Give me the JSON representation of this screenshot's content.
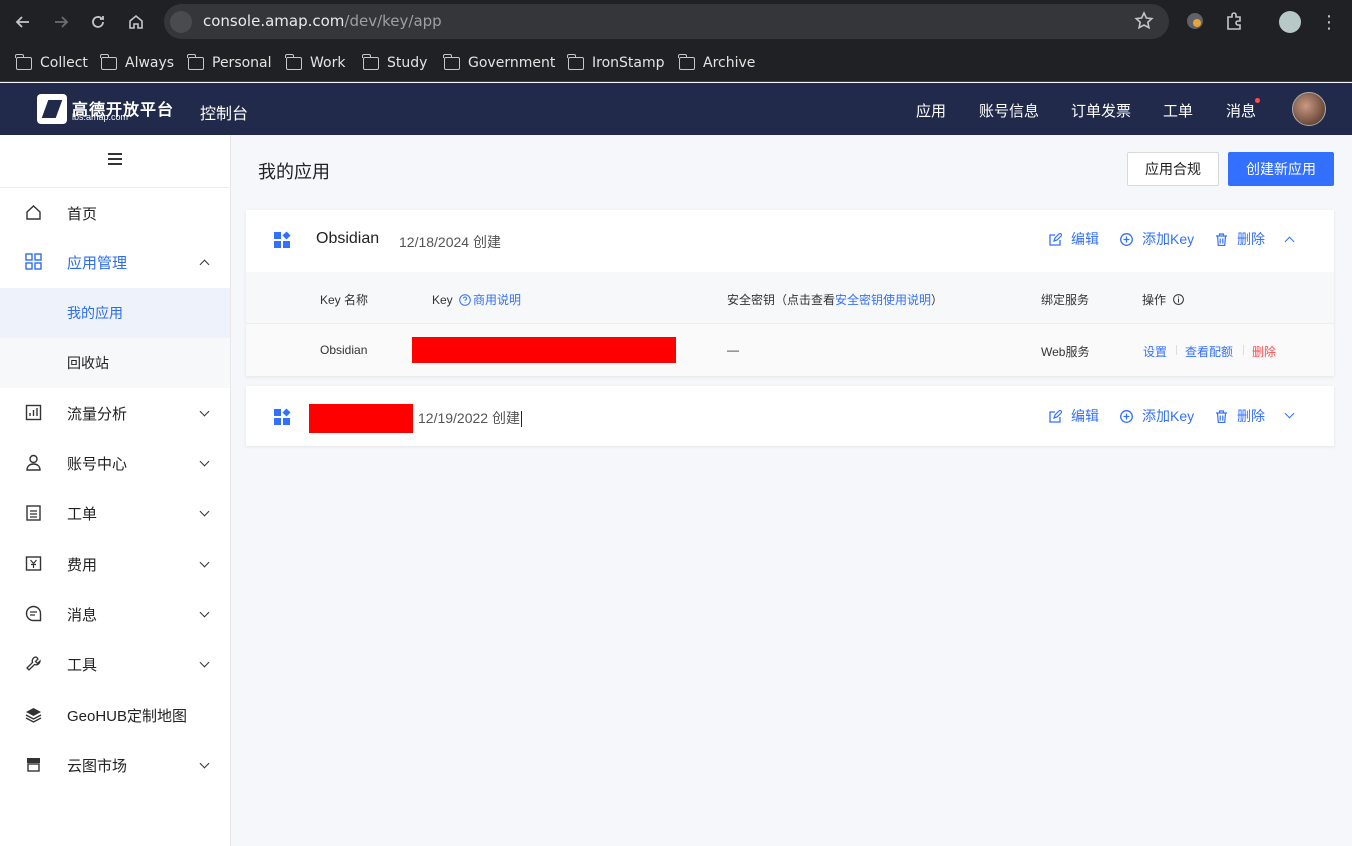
{
  "browser": {
    "url_host": "console.amap.com",
    "url_path": "/dev/key/app",
    "bookmarks": [
      "Collect",
      "Always",
      "Personal",
      "Work",
      "Study",
      "Government",
      "IronStamp",
      "Archive"
    ]
  },
  "header": {
    "logo_text": "高德开放平台",
    "logo_sub": "lbs.amap.com",
    "console_title": "控制台",
    "nav": [
      "应用",
      "账号信息",
      "订单发票",
      "工单",
      "消息"
    ]
  },
  "sidebar": {
    "items": [
      {
        "label": "首页",
        "icon": "home-icon"
      },
      {
        "label": "应用管理",
        "icon": "apps-grid-icon"
      },
      {
        "label": "流量分析",
        "icon": "chart-icon"
      },
      {
        "label": "账号中心",
        "icon": "user-icon"
      },
      {
        "label": "工单",
        "icon": "ticket-icon"
      },
      {
        "label": "费用",
        "icon": "yen-icon"
      },
      {
        "label": "消息",
        "icon": "message-icon"
      },
      {
        "label": "工具",
        "icon": "wrench-icon"
      },
      {
        "label": "GeoHUB定制地图",
        "icon": "layers-icon"
      },
      {
        "label": "云图市场",
        "icon": "store-icon"
      }
    ],
    "sub_items": [
      "我的应用",
      "回收站"
    ]
  },
  "main": {
    "title": "我的应用",
    "btn_compliance": "应用合规",
    "btn_create": "创建新应用",
    "actions": {
      "edit": "编辑",
      "add_key": "添加Key",
      "delete": "删除"
    },
    "apps": [
      {
        "name": "Obsidian",
        "date": "12/18/2024 创建",
        "expanded": true
      },
      {
        "name": "",
        "date": "12/19/2022 创建",
        "expanded": false
      }
    ],
    "table": {
      "headers": {
        "key_name": "Key 名称",
        "key": "Key",
        "key_link": "商用说明",
        "secret_prefix": "安全密钥（点击查看",
        "secret_link": "安全密钥使用说明",
        "secret_suffix": "）",
        "service": "绑定服务",
        "ops": "操作"
      },
      "rows": [
        {
          "name": "Obsidian",
          "secret": "—",
          "service": "Web服务",
          "ops": [
            "设置",
            "查看配额",
            "删除"
          ]
        }
      ]
    }
  }
}
